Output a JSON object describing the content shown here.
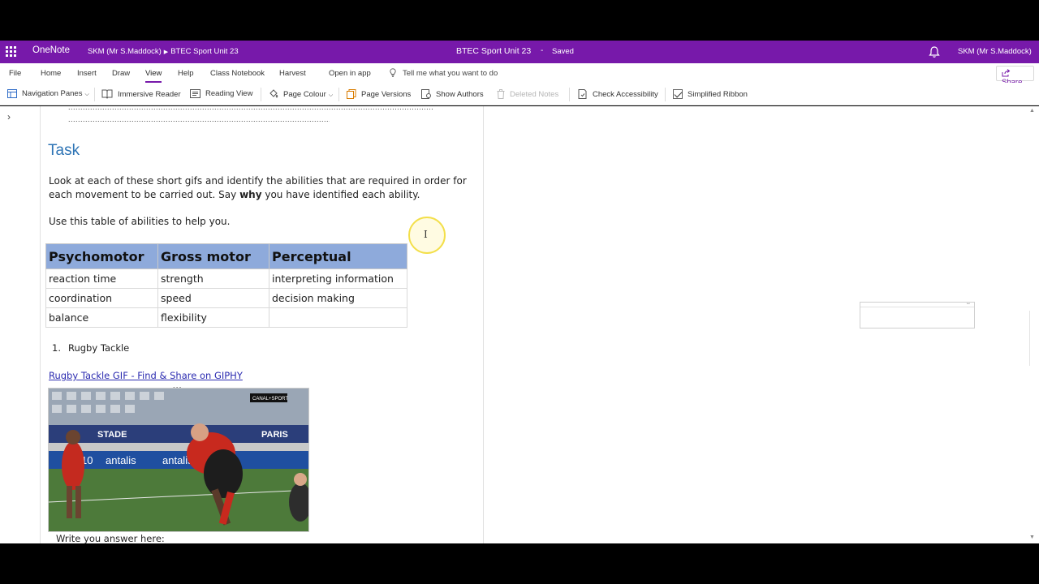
{
  "titlebar": {
    "app_name": "OneNote",
    "breadcrumb_notebook": "SKM (Mr S.Maddock)",
    "breadcrumb_section": "BTEC Sport Unit 23",
    "doc_title": "BTEC Sport Unit 23",
    "separator": "-",
    "status": "Saved",
    "user": "SKM (Mr S.Maddock)",
    "accent": "#7719aa"
  },
  "menu": {
    "file": "File",
    "home": "Home",
    "insert": "Insert",
    "draw": "Draw",
    "view": "View",
    "help": "Help",
    "class_notebook": "Class Notebook",
    "harvest": "Harvest",
    "open_in_app": "Open in app",
    "tell_me": "Tell me what you want to do",
    "share": "Share",
    "active_tab": "View"
  },
  "ribbon": {
    "navigation_panes": "Navigation Panes",
    "immersive_reader": "Immersive Reader",
    "reading_view": "Reading View",
    "page_colour": "Page Colour",
    "page_versions": "Page Versions",
    "show_authors": "Show Authors",
    "deleted_notes": "Deleted Notes",
    "check_accessibility": "Check Accessibility",
    "simplified_ribbon": "Simplified Ribbon"
  },
  "page": {
    "dots_line_1": "......................................................................................................................................................",
    "dots_line_2": "............................................................................................................",
    "heading": "Task",
    "instruction_part1": "Look at each of these short gifs and identify the abilities that are required in order for each movement to be carried out. Say ",
    "instruction_bold": "why",
    "instruction_part2": " you have identified each ability.",
    "table_intro": "Use this table of abilities to help you.",
    "table": {
      "headers": [
        "Psychomotor",
        "Gross motor",
        "Perceptual"
      ],
      "rows": [
        [
          "reaction time",
          "strength",
          "interpreting information"
        ],
        [
          "coordination",
          "speed",
          "decision making"
        ],
        [
          "balance",
          "flexibility",
          ""
        ]
      ],
      "header_color": "#8eaadb"
    },
    "list_number": "1.",
    "list_item": "Rugby Tackle",
    "gif_link": "Rugby Tackle GIF - Find & Share on GIPHY",
    "gif_handle": "•••",
    "gif_logo": "CANAL+SPORT",
    "gif_board_1": "STADE",
    "gif_board_2": "PARIS",
    "gif_board_3": "antalis",
    "gif_board_4": "antalis",
    "gif_board_5": "10",
    "answer_prompt": "Write you answer here:"
  }
}
